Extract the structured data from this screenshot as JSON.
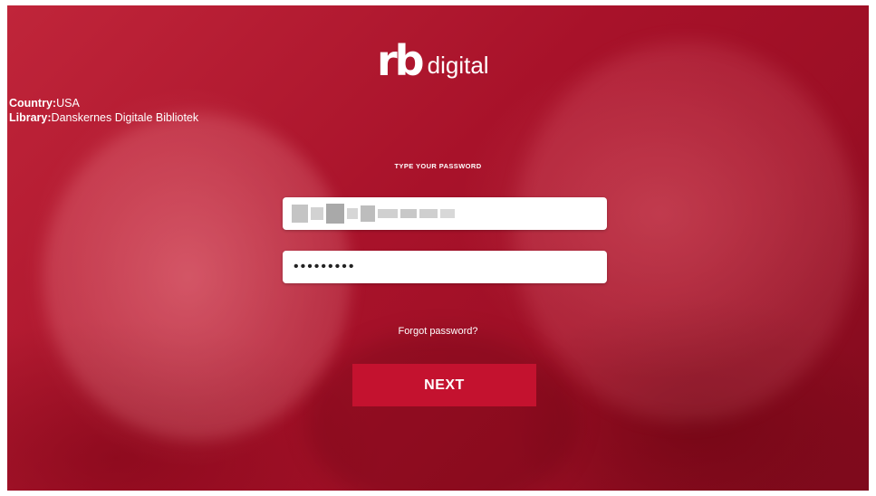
{
  "brand": {
    "logo_mark": "rb",
    "logo_text": "digital",
    "accent_color": "#c4122f",
    "background_color": "#a8122a"
  },
  "info": {
    "country_label": "Country:",
    "country_value": "USA",
    "library_label": "Library:",
    "library_value": "Danskernes Digitale Bibliotek"
  },
  "login": {
    "prompt": "TYPE YOUR PASSWORD",
    "password_value": "•••••••••",
    "forgot_password": "Forgot password?",
    "next_label": "NEXT"
  }
}
